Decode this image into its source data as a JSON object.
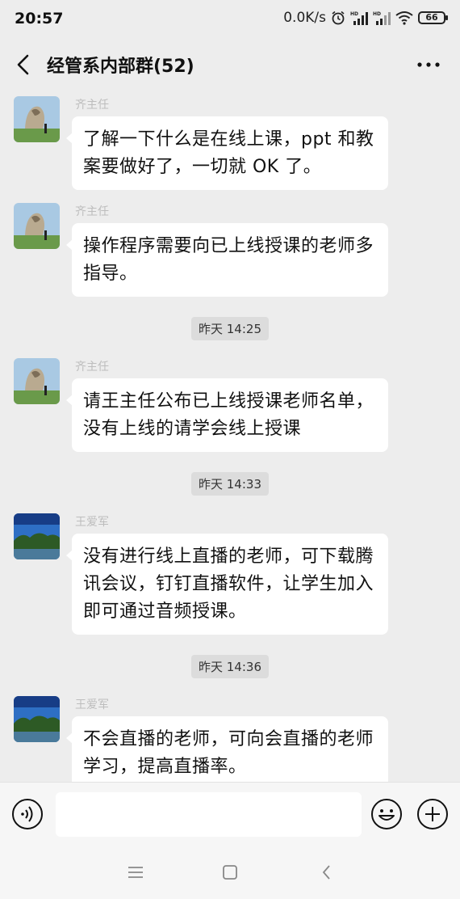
{
  "status_bar": {
    "time": "20:57",
    "speed": "0.0K/s",
    "battery": "66",
    "icons": [
      "alarm-icon",
      "signal-icon",
      "signal-icon",
      "wifi-icon",
      "battery-icon"
    ]
  },
  "header": {
    "title": "经管系内部群(52)",
    "back_icon": "chevron-left-icon",
    "more_icon": "more-icon"
  },
  "messages": [
    {
      "sender": "齐主任",
      "text": "了解一下什么是在线上课，ppt 和教案要做好了，一切就 OK 了。"
    },
    {
      "sender": "齐主任",
      "text": "操作程序需要向已上线授课的老师多指导。"
    },
    {
      "timestamp": "昨天 14:25"
    },
    {
      "sender": "齐主任",
      "text": "请王主任公布已上线授课老师名单，没有上线的请学会线上授课"
    },
    {
      "timestamp": "昨天 14:33"
    },
    {
      "sender": "王爱军",
      "text": "没有进行线上直播的老师，可下载腾讯会议，钉钉直播软件，让学生加入即可通过音频授课。"
    },
    {
      "timestamp": "昨天 14:36"
    },
    {
      "sender": "王爱军",
      "text": "不会直播的老师，可向会直播的老师学习，提高直播率。"
    }
  ],
  "input_bar": {
    "value": "",
    "icons": [
      "voice-icon",
      "emoji-icon",
      "plus-icon"
    ]
  },
  "nav_bar": {
    "icons": [
      "menu-icon",
      "home-icon",
      "back-icon"
    ]
  }
}
